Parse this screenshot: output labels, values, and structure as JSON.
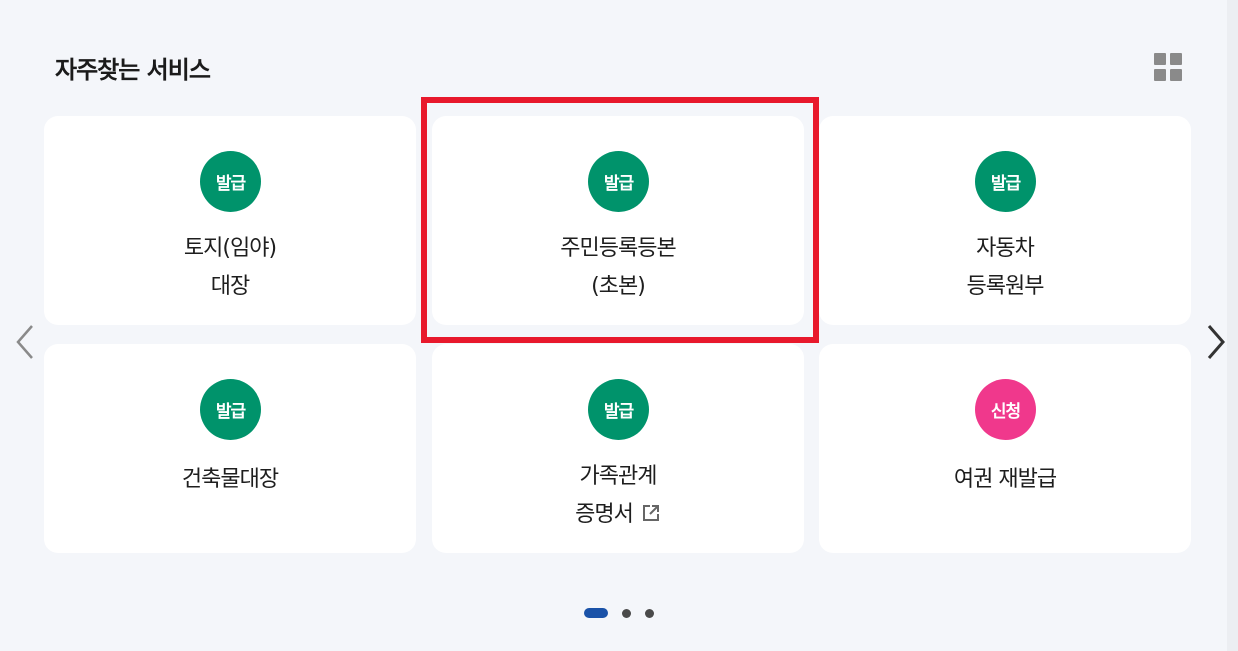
{
  "section": {
    "title": "자주찾는 서비스",
    "view_toggle_icon": "grid-icon"
  },
  "cards": [
    {
      "badge": "발급",
      "badge_type": "issue",
      "label_lines": [
        "토지(임야)",
        "대장"
      ],
      "external": false
    },
    {
      "badge": "발급",
      "badge_type": "issue",
      "label_lines": [
        "주민등록등본",
        "(초본)"
      ],
      "external": false,
      "highlighted": true
    },
    {
      "badge": "발급",
      "badge_type": "issue",
      "label_lines": [
        "자동차",
        "등록원부"
      ],
      "external": false
    },
    {
      "badge": "발급",
      "badge_type": "issue",
      "label_lines": [
        "건축물대장"
      ],
      "external": false
    },
    {
      "badge": "발급",
      "badge_type": "issue",
      "label_lines": [
        "가족관계",
        "증명서"
      ],
      "external": true
    },
    {
      "badge": "신청",
      "badge_type": "apply",
      "label_lines": [
        "여권 재발급"
      ],
      "external": false
    }
  ],
  "colors": {
    "issue_badge": "#00936b",
    "apply_badge": "#f0388c",
    "highlight_border": "#e8192c",
    "active_dot": "#1a52a8"
  },
  "carousel": {
    "prev_icon": "chevron-left-icon",
    "next_icon": "chevron-right-icon",
    "pages": 3,
    "current_page": 1
  }
}
